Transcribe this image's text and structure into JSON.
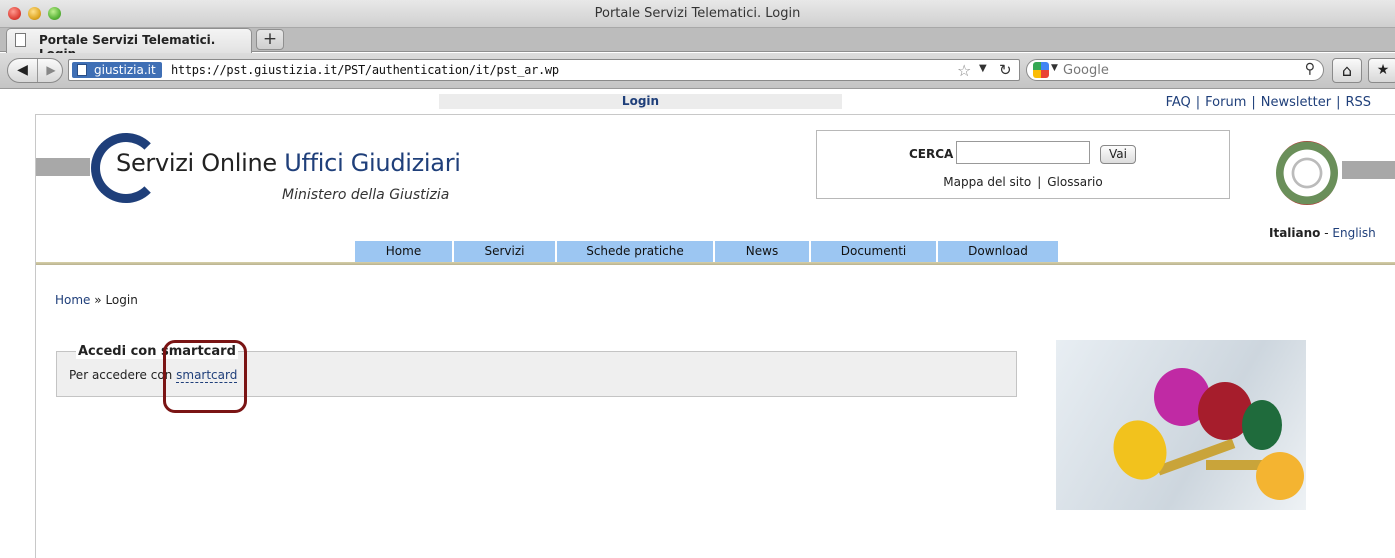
{
  "window": {
    "title": "Portale Servizi Telematici. Login"
  },
  "tabs": [
    {
      "label": "Portale Servizi Telematici. Login"
    }
  ],
  "toolbar": {
    "site_identity": "giustizia.it",
    "url": "https://pst.giustizia.it/PST/authentication/it/pst_ar.wp",
    "search_engine": "Google"
  },
  "page": {
    "login_strip": "Login",
    "top_links": [
      {
        "label": "FAQ"
      },
      {
        "label": "Forum"
      },
      {
        "label": "Newsletter"
      },
      {
        "label": "RSS"
      }
    ],
    "logo": {
      "word1_letter": "S",
      "word1_rest": "ervizi",
      "word2": "Online",
      "word3": "Uffici Giudiziari",
      "subtitle": "Ministero della Giustizia"
    },
    "search_box": {
      "label": "CERCA",
      "button": "Vai",
      "links": [
        {
          "label": "Mappa del sito"
        },
        {
          "label": "Glossario"
        }
      ]
    },
    "language": {
      "current": "Italiano",
      "separator": "-",
      "other": "English"
    },
    "menu": [
      {
        "label": "Home"
      },
      {
        "label": "Servizi"
      },
      {
        "label": "Schede pratiche"
      },
      {
        "label": "News"
      },
      {
        "label": "Documenti"
      },
      {
        "label": "Download"
      }
    ],
    "breadcrumb": {
      "home": "Home",
      "separator": "»",
      "current": "Login"
    },
    "smartcard": {
      "legend": "Accedi con smartcard",
      "text": "Per accedere con",
      "link": "smartcard"
    }
  },
  "colors": {
    "brand": "#1f3f7a",
    "menu_bg": "#9cc6f2",
    "highlight": "#7a1414"
  }
}
